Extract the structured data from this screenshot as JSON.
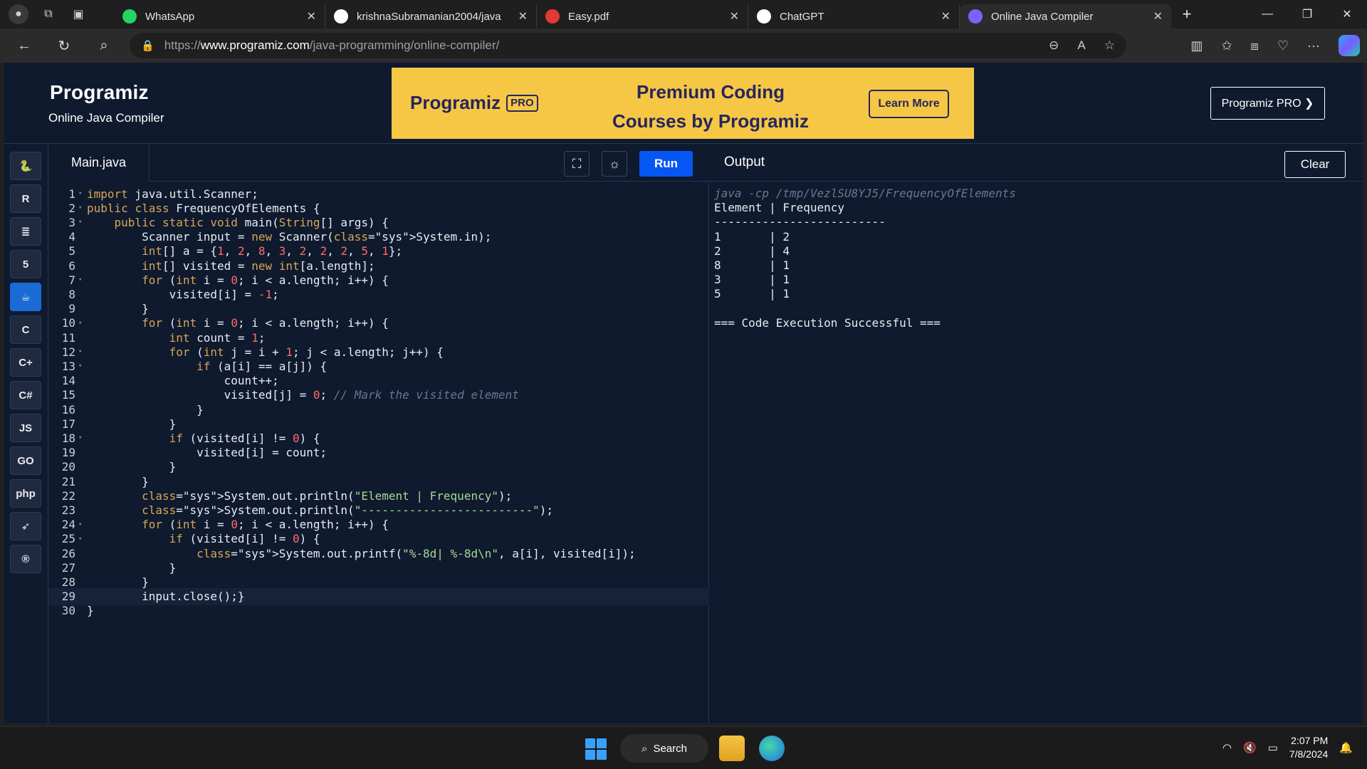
{
  "browser": {
    "tabs": [
      {
        "title": "WhatsApp",
        "favicon": "whatsapp-icon",
        "color": "#25d366"
      },
      {
        "title": "krishnaSubramanian2004/java",
        "favicon": "github-icon",
        "color": "#ffffff"
      },
      {
        "title": "Easy.pdf",
        "favicon": "pdf-icon",
        "color": "#e53935"
      },
      {
        "title": "ChatGPT",
        "favicon": "chatgpt-icon",
        "color": "#ffffff"
      },
      {
        "title": "Online Java Compiler",
        "favicon": "programiz-icon",
        "color": "#7b61ff"
      }
    ],
    "active_tab": 4,
    "url_prefix": "https://",
    "url_host": "www.programiz.com",
    "url_path": "/java-programming/online-compiler/"
  },
  "site": {
    "logo": "Programiz",
    "subtitle": "Online Java Compiler",
    "banner": {
      "logo": "Programiz",
      "badge": "PRO",
      "line1": "Premium Coding",
      "line2": "Courses by Programiz",
      "button": "Learn More"
    },
    "pro_button": "Programiz PRO ❯"
  },
  "sidebar": {
    "languages": [
      {
        "name": "python-icon",
        "glyph": "🐍"
      },
      {
        "name": "r-icon",
        "glyph": "R"
      },
      {
        "name": "sql-icon",
        "glyph": "≣"
      },
      {
        "name": "html-icon",
        "glyph": "5"
      },
      {
        "name": "java-icon",
        "glyph": "☕",
        "active": true
      },
      {
        "name": "c-icon",
        "glyph": "C"
      },
      {
        "name": "cpp-icon",
        "glyph": "C+"
      },
      {
        "name": "csharp-icon",
        "glyph": "C#"
      },
      {
        "name": "js-icon",
        "glyph": "JS"
      },
      {
        "name": "go-icon",
        "glyph": "GO"
      },
      {
        "name": "php-icon",
        "glyph": "php"
      },
      {
        "name": "swift-icon",
        "glyph": "➶"
      },
      {
        "name": "rust-icon",
        "glyph": "®"
      }
    ]
  },
  "editor": {
    "filename": "Main.java",
    "run_label": "Run",
    "current_line": 29,
    "lines": [
      "import java.util.Scanner;",
      "public class FrequencyOfElements {",
      "    public static void main(String[] args) {",
      "        Scanner input = new Scanner(System.in);",
      "        int[] a = {1, 2, 8, 3, 2, 2, 2, 5, 1};",
      "        int[] visited = new int[a.length];",
      "        for (int i = 0; i < a.length; i++) {",
      "            visited[i] = -1;",
      "        }",
      "        for (int i = 0; i < a.length; i++) {",
      "            int count = 1;",
      "            for (int j = i + 1; j < a.length; j++) {",
      "                if (a[i] == a[j]) {",
      "                    count++;",
      "                    visited[j] = 0; // Mark the visited element",
      "                }",
      "            }",
      "            if (visited[i] != 0) {",
      "                visited[i] = count;",
      "            }",
      "        }",
      "        System.out.println(\"Element | Frequency\");",
      "        System.out.println(\"-------------------------\");",
      "        for (int i = 0; i < a.length; i++) {",
      "            if (visited[i] != 0) {",
      "                System.out.printf(\"%-8d| %-8d\\n\", a[i], visited[i]);",
      "            }",
      "        }",
      "        input.close();}",
      "}"
    ],
    "foldable_lines": [
      1,
      2,
      3,
      7,
      10,
      12,
      13,
      18,
      24,
      25
    ]
  },
  "output": {
    "title": "Output",
    "clear_label": "Clear",
    "command": "java -cp /tmp/VezlSU8YJ5/FrequencyOfElements",
    "lines": [
      "Element | Frequency",
      "-------------------------",
      "1       | 2",
      "2       | 4",
      "8       | 1",
      "3       | 1",
      "5       | 1",
      "",
      "=== Code Execution Successful ==="
    ]
  },
  "taskbar": {
    "search_label": "Search",
    "time": "2:07 PM",
    "date": "7/8/2024"
  }
}
